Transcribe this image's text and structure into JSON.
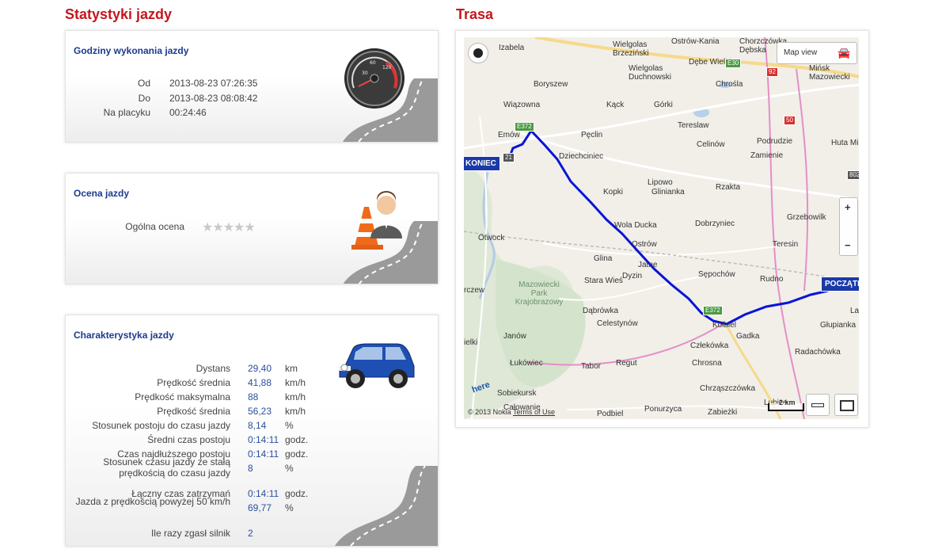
{
  "left_heading": "Statystyki jazdy",
  "right_heading": "Trasa",
  "hours_panel": {
    "title": "Godziny wykonania jazdy",
    "rows": [
      {
        "label": "Od",
        "value": "2013-08-23 07:26:35"
      },
      {
        "label": "Do",
        "value": "2013-08-23 08:08:42"
      },
      {
        "label": "Na placyku",
        "value": "00:24:46"
      }
    ],
    "icon": "speedometer-icon"
  },
  "rating_panel": {
    "title": "Ocena jazdy",
    "label": "Ogólna ocena",
    "stars_filled": 0,
    "stars_total": 5,
    "icon": "instructor-with-cone-icon"
  },
  "char_panel": {
    "title": "Charakterystyka jazdy",
    "icon": "car-icon",
    "rows": [
      {
        "label": "Dystans",
        "value": "29,40",
        "unit": "km"
      },
      {
        "label": "Prędkość średnia",
        "value": "41,88",
        "unit": "km/h"
      },
      {
        "label": "Prędkość maksymalna",
        "value": "88",
        "unit": "km/h"
      },
      {
        "label": "Prędkość średnia",
        "value": "56,23",
        "unit": "km/h"
      },
      {
        "label": "Stosunek postoju do czasu jazdy",
        "value": "8,14",
        "unit": "%"
      },
      {
        "label": "Średni czas postoju",
        "value": "0:14:11",
        "unit": "godz."
      },
      {
        "label": "Czas najdłuższego postoju",
        "value": "0:14:11",
        "unit": "godz."
      },
      {
        "label": "Stosunek czasu jazdy ze stałą prędkością do czasu jazdy",
        "value": "8",
        "unit": "%"
      },
      {
        "label": "Łączny czas zatrzymań",
        "value": "0:14:11",
        "unit": "godz."
      },
      {
        "label": "Jazda z prędkością powyżej 50 km/h",
        "value": "69,77",
        "unit": "%"
      },
      {
        "label": "Ile razy zgasł silnik",
        "value": "2",
        "unit": ""
      }
    ]
  },
  "map": {
    "map_view_label": "Map view",
    "start_tag": "POCZĄTEK",
    "end_tag": "KONIEC",
    "zoom_in": "+",
    "zoom_out": "−",
    "scale_label": "2 km",
    "copyright": "© 2013 Nokia",
    "terms": "Terms of Use",
    "brand": "here",
    "route_color": "#0a14d8",
    "places": [
      "Izabela",
      "Wielgolas Brzeziński",
      "Ostrów-Kania",
      "Chorzczówka Dębska",
      "Dębe Wielkie",
      "Wielgolas Duchnowski",
      "Chrośla",
      "Boryszew",
      "Mińsk Mazowiecki",
      "Wiązowna",
      "Kąck",
      "Górki",
      "Emów",
      "Pęclin",
      "Tereslaw",
      "Celinów",
      "Podrudzie",
      "Zamienie",
      "Huta Mińska",
      "Dziechciniec",
      "Lipowo",
      "Glinianka",
      "Rzakta",
      "Kopki",
      "Wola Ducka",
      "Dobrzyniec",
      "Grzebowilk",
      "Otwock",
      "Ostrów",
      "Teresin",
      "Glina",
      "Jatne",
      "Dyzin",
      "Sępochów",
      "Rudno",
      "Mazowiecki Park Krajobrazowy",
      "Stara Wieś",
      "Dąbrówka",
      "Celestynów",
      "Kołbiel",
      "Gadka",
      "Głupianka",
      "Janów",
      "Człekówka",
      "Radachówka",
      "Łukówiec",
      "Tabor",
      "Regut",
      "Chrosna",
      "Sobiekursk",
      "Chrząszczówka",
      "Całowanie",
      "Podbiel",
      "Ponurzyca",
      "Zabieżki",
      "Lubice",
      "rczew",
      "ielki",
      "La"
    ],
    "road_badges": [
      "E30",
      "92",
      "50",
      "E372",
      "E372",
      "21",
      "802"
    ]
  }
}
